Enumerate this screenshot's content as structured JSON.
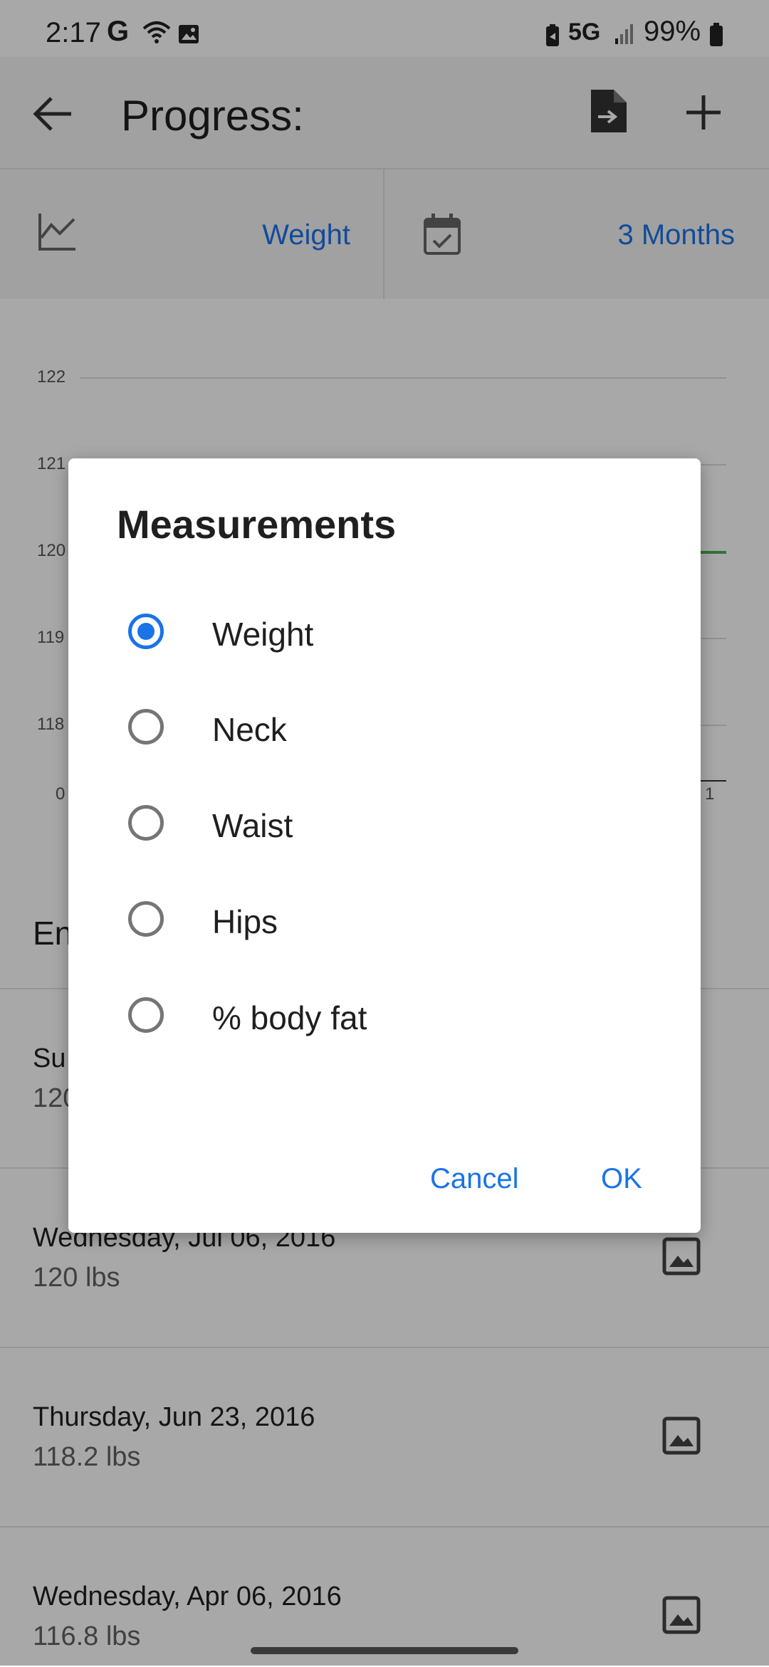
{
  "status_bar": {
    "time": "2:17",
    "g_label": "G",
    "network": "5G",
    "battery": "99%"
  },
  "app_bar": {
    "title": "Progress:"
  },
  "filters": {
    "measurement": "Weight",
    "period": "3 Months"
  },
  "chart": {
    "y_ticks": [
      "122",
      "121",
      "120",
      "119",
      "118"
    ],
    "x_ticks": [
      "0",
      "1"
    ],
    "colors": {
      "line": "#4caf50"
    }
  },
  "entries_header": "En",
  "entries": [
    {
      "date": "Su",
      "value": "120"
    },
    {
      "date": "Wednesday, Jul 06, 2016",
      "value": "120 lbs"
    },
    {
      "date": "Thursday, Jun 23, 2016",
      "value": "118.2 lbs"
    },
    {
      "date": "Wednesday, Apr 06, 2016",
      "value": "116.8 lbs"
    }
  ],
  "dialog": {
    "title": "Measurements",
    "options": [
      {
        "label": "Weight",
        "selected": true
      },
      {
        "label": "Neck",
        "selected": false
      },
      {
        "label": "Waist",
        "selected": false
      },
      {
        "label": "Hips",
        "selected": false
      },
      {
        "label": "% body fat",
        "selected": false
      }
    ],
    "cancel_label": "Cancel",
    "ok_label": "OK"
  },
  "colors": {
    "accent": "#1a73e8"
  }
}
